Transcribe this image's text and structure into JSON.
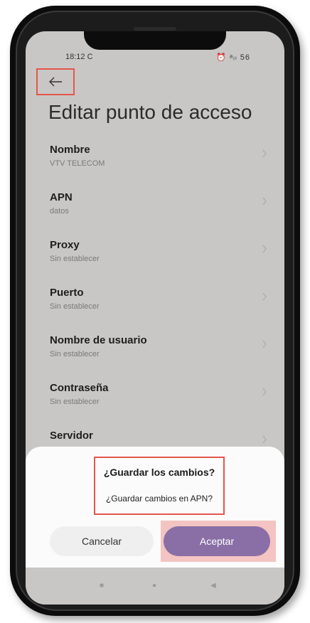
{
  "status_bar": {
    "time": "18:12",
    "sync_icon": "C",
    "icons_text": "⏰ ᵃᵢₗ 56"
  },
  "header": {
    "back_icon": "arrow-left-icon",
    "title": "Editar punto de acceso"
  },
  "settings": [
    {
      "label": "Nombre",
      "value": "VTV TELECOM"
    },
    {
      "label": "APN",
      "value": "datos"
    },
    {
      "label": "Proxy",
      "value": "Sin establecer"
    },
    {
      "label": "Puerto",
      "value": "Sin establecer"
    },
    {
      "label": "Nombre de usuario",
      "value": "Sin establecer"
    },
    {
      "label": "Contraseña",
      "value": "Sin establecer"
    },
    {
      "label": "Servidor",
      "value": ""
    }
  ],
  "dialog": {
    "title": "¿Guardar los cambios?",
    "message": "¿Guardar cambios en APN?",
    "cancel_label": "Cancelar",
    "accept_label": "Aceptar"
  },
  "colors": {
    "highlight": "#e3574c",
    "accept": "#8a6fa6",
    "background": "#c8c7c5"
  }
}
